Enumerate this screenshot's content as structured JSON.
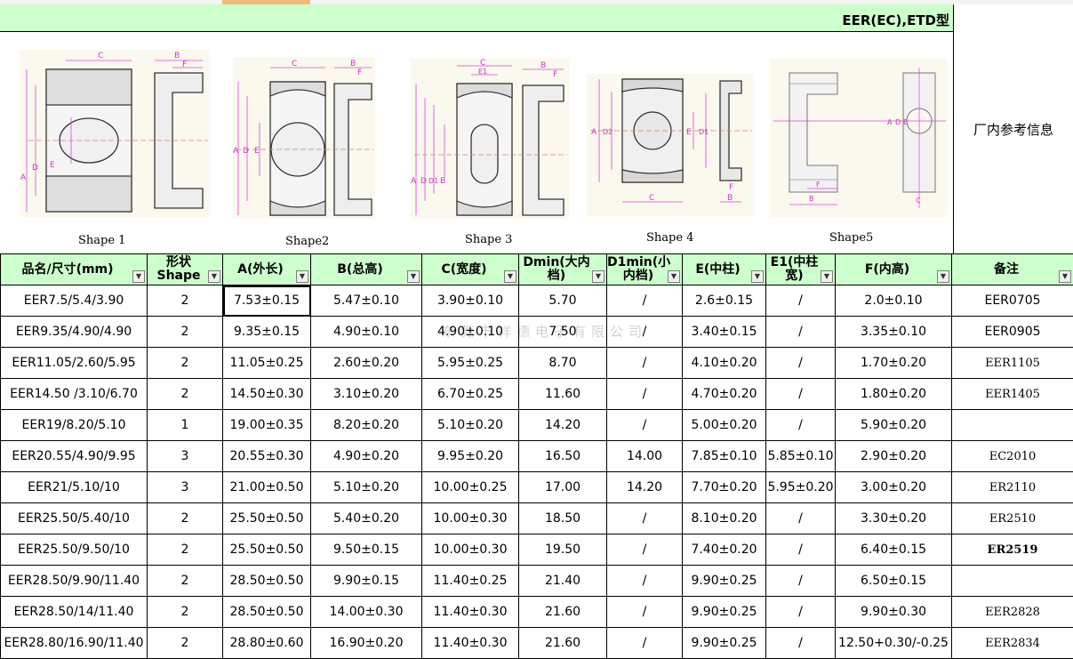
{
  "title": "EER(EC),ETD型",
  "factory_info": "厂内参考信息",
  "watermark": "东莞市祥德电子有限公司",
  "shapes": [
    {
      "caption": "Shape 1"
    },
    {
      "caption": "Shape2"
    },
    {
      "caption": "Shape 3"
    },
    {
      "caption": "Shape 4"
    },
    {
      "caption": "Shape5"
    }
  ],
  "dim_letters": {
    "a": "A",
    "b": "B",
    "c": "C",
    "d": "D",
    "e": "E",
    "f": "F",
    "e1": "E1",
    "d1": "D1",
    "d2": "D2"
  },
  "headers": [
    "品名/尺寸(mm)",
    "形状Shape",
    "A(外长)",
    "B(总高)",
    "C(宽度)",
    "Dmin(大内档)",
    "D1min(小内档)",
    "E(中柱)",
    "E1(中柱宽)",
    "F(内高)",
    "备注"
  ],
  "rows": [
    [
      "EER7.5/5.4/3.90",
      "2",
      "7.53±0.15",
      "5.47±0.10",
      "3.90±0.10",
      "5.70",
      "/",
      "2.6±0.15",
      "/",
      "2.0±0.10",
      "EER0705"
    ],
    [
      "EER9.35/4.90/4.90",
      "2",
      "9.35±0.15",
      "4.90±0.10",
      "4.90±0.10",
      "7.50",
      "/",
      "3.40±0.15",
      "/",
      "3.35±0.10",
      "EER0905"
    ],
    [
      "EER11.05/2.60/5.95",
      "2",
      "11.05±0.25",
      "2.60±0.20",
      "5.95±0.25",
      "8.70",
      "/",
      "4.10±0.20",
      "/",
      "1.70±0.20",
      "EER1105"
    ],
    [
      "EER14.50 /3.10/6.70",
      "2",
      "14.50±0.30",
      "3.10±0.20",
      "6.70±0.25",
      "11.60",
      "/",
      "4.70±0.20",
      "/",
      "1.80±0.20",
      "EER1405"
    ],
    [
      "EER19/8.20/5.10",
      "1",
      "19.00±0.35",
      "8.20±0.20",
      "5.10±0.20",
      "14.20",
      "/",
      "5.00±0.20",
      "/",
      "5.90±0.20",
      ""
    ],
    [
      "EER20.55/4.90/9.95",
      "3",
      "20.55±0.30",
      "4.90±0.20",
      "9.95±0.20",
      "16.50",
      "14.00",
      "7.85±0.10",
      "5.85±0.10",
      "2.90±0.20",
      "EC2010"
    ],
    [
      "EER21/5.10/10",
      "3",
      "21.00±0.50",
      "5.10±0.20",
      "10.00±0.25",
      "17.00",
      "14.20",
      "7.70±0.20",
      "5.95±0.20",
      "3.00±0.20",
      "ER2110"
    ],
    [
      "EER25.50/5.40/10",
      "2",
      "25.50±0.50",
      "5.40±0.20",
      "10.00±0.30",
      "18.50",
      "/",
      "8.10±0.20",
      "/",
      "3.30±0.20",
      "ER2510"
    ],
    [
      "EER25.50/9.50/10",
      "2",
      "25.50±0.50",
      "9.50±0.15",
      "10.00±0.30",
      "19.50",
      "/",
      "7.40±0.20",
      "/",
      "6.40±0.15",
      "ER2519"
    ],
    [
      "EER28.50/9.90/11.40",
      "2",
      "28.50±0.50",
      "9.90±0.15",
      "11.40±0.25",
      "21.40",
      "/",
      "9.90±0.25",
      "/",
      "6.50±0.15",
      ""
    ],
    [
      "EER28.50/14/11.40",
      "2",
      "28.50±0.50",
      "14.00±0.30",
      "11.40±0.30",
      "21.60",
      "/",
      "9.90±0.25",
      "/",
      "9.90±0.30",
      "EER2828"
    ],
    [
      "EER28.80/16.90/11.40",
      "2",
      "28.80±0.60",
      "16.90±0.20",
      "11.40±0.30",
      "21.60",
      "/",
      "9.90±0.25",
      "/",
      "12.50+0.30/-0.25",
      "EER2834"
    ]
  ],
  "dropdown_icon": "dropdown-arrow-icon"
}
